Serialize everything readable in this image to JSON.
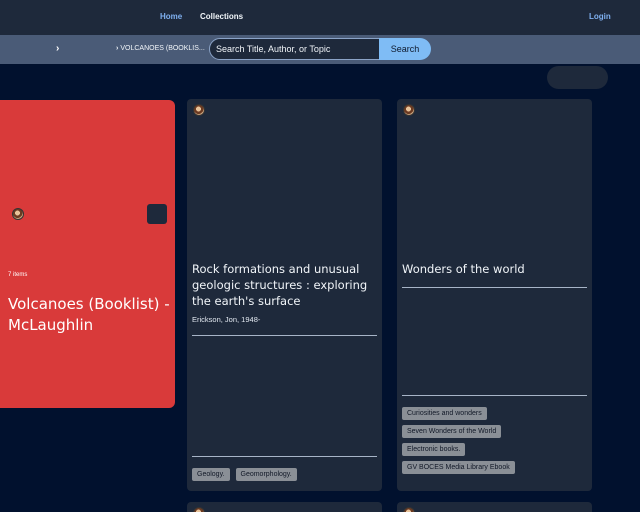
{
  "nav": {
    "home_label": "Home",
    "collections_label": "Collections",
    "login_label": "Login"
  },
  "search": {
    "breadcrumb_chevron": "›",
    "breadcrumb_separator": "›",
    "breadcrumb_label": "VOLCANOES (BOOKLIS...",
    "placeholder": "Search Title, Author, or Topic",
    "button_label": "Search"
  },
  "collection": {
    "count_label": "7 items",
    "title": "Volcanoes (Booklist) - McLaughlin",
    "color": "#d93a3a"
  },
  "books": [
    {
      "title": "Rock formations and unusual geologic structures : exploring the earth's surface",
      "author": "Erickson, Jon, 1948-",
      "tags": [
        "Geology.",
        "Geomorphology."
      ]
    },
    {
      "title": "Wonders of the world",
      "author": "",
      "tags": [
        "Curiosities and wonders",
        "Seven Wonders of the World",
        "Electronic books.",
        "GV BOCES Media Library Ebook"
      ]
    }
  ],
  "colors": {
    "background": "#01112e",
    "nav_bg": "#1e293b",
    "search_bar_bg": "#4a5b77",
    "accent_link": "#7fb0f0",
    "search_button": "#7fbcf5",
    "card_bg": "#1e293b",
    "tag_bg": "#8a8f96"
  }
}
